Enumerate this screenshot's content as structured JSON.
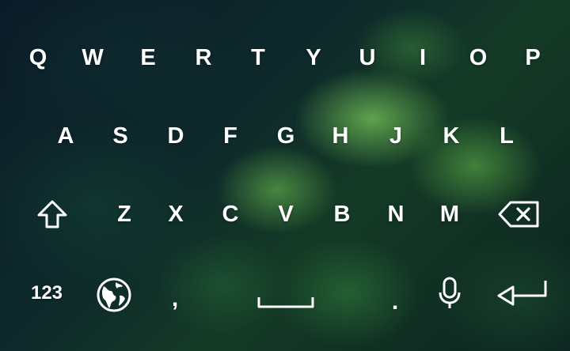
{
  "keyboard": {
    "row1": [
      "Q",
      "W",
      "E",
      "R",
      "T",
      "Y",
      "U",
      "I",
      "O",
      "P"
    ],
    "row2": [
      "A",
      "S",
      "D",
      "F",
      "G",
      "H",
      "J",
      "K",
      "L"
    ],
    "row3": [
      "Z",
      "X",
      "C",
      "V",
      "B",
      "N",
      "M"
    ],
    "row4": {
      "numbers_label": "123",
      "comma": ",",
      "period": "."
    },
    "icons": {
      "shift": "shift-icon",
      "backspace": "backspace-icon",
      "language": "globe-icon",
      "space": "space-bar-icon",
      "voice": "microphone-icon",
      "enter": "enter-icon"
    }
  },
  "colors": {
    "key_text": "#ffffff",
    "background_dark": "#0b1a24",
    "leaf_green": "#4e9a3c"
  }
}
